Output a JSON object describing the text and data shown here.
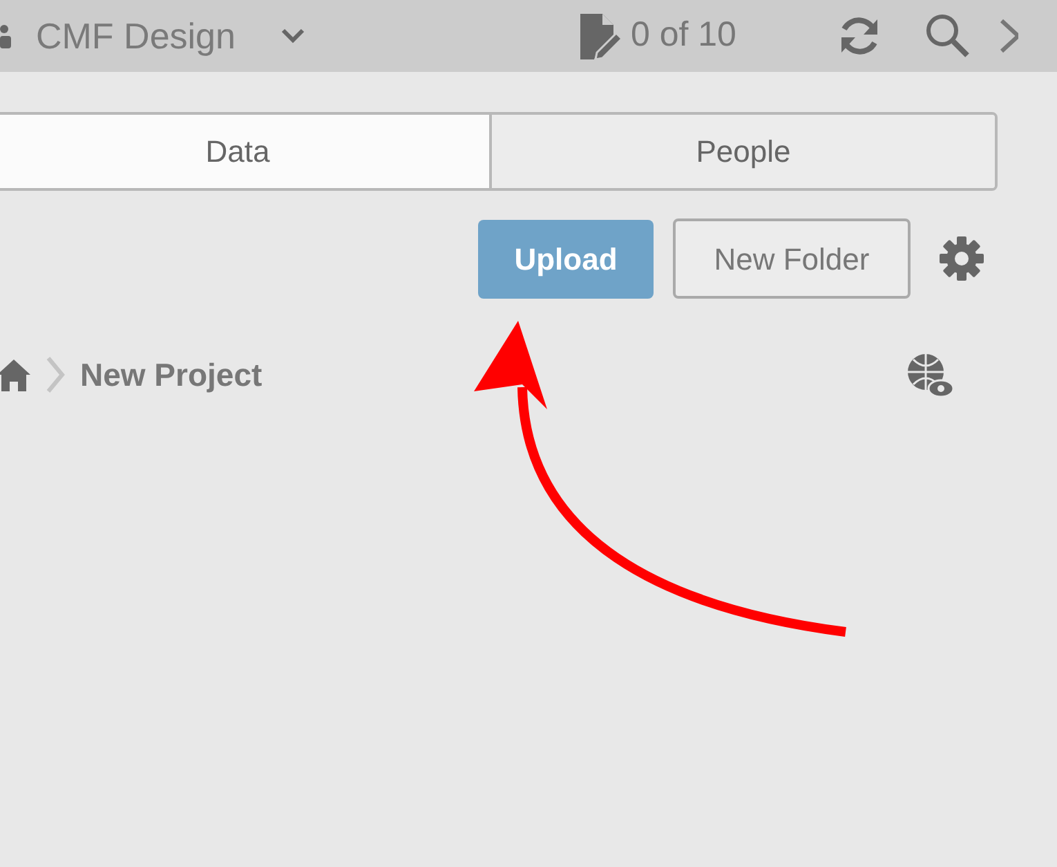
{
  "header": {
    "project": "CMF Design",
    "count": "0 of 10"
  },
  "tabs": [
    {
      "label": "Data",
      "selected": true
    },
    {
      "label": "People",
      "selected": false
    }
  ],
  "toolbar": {
    "buttons": [
      {
        "label": "Upload",
        "kind": "primary"
      },
      {
        "label": "New Folder",
        "kind": "outline"
      }
    ]
  },
  "breadcrumb": {
    "current": "New Project"
  }
}
